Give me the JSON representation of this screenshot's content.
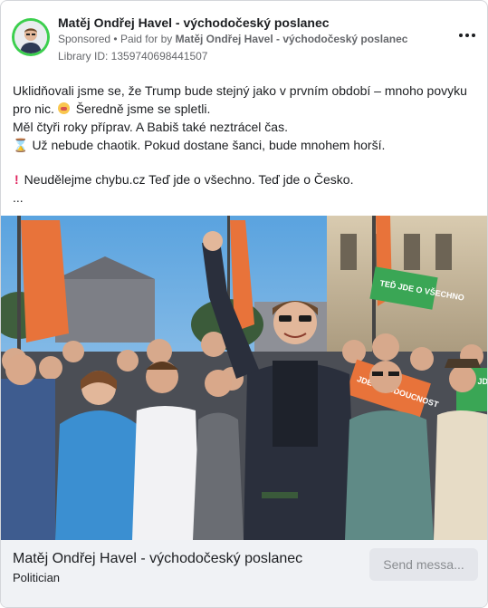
{
  "ad": {
    "page_name": "Matěj Ondřej Havel - východočeský poslanec",
    "sponsored_label": "Sponsored",
    "paid_for_prefix": "Paid for by",
    "paid_for_name": "Matěj Ondřej Havel - východočeský poslanec",
    "library_id": "Library ID: 1359740698441507",
    "more_icon": "more-horizontal-icon",
    "avatar_ring_color": "#3ccf4e"
  },
  "body": {
    "line1": "Uklidňovali jsme se, že Trump bude stejný jako v prvním období – mnoho povyku",
    "line2_pre": "pro nic.",
    "line2_post": "Šeredně jsme se spletli.",
    "line3": "Měl čtyři roky příprav. A Babiš také neztrácel čas.",
    "line4": "Už nebude chaotik. Pokud dostane šanci, bude mnohem horší.",
    "line5": "Neudělejme chybu.cz Teď jde o všechno. Teď jde o Česko.",
    "truncation": "..."
  },
  "photo": {
    "signs": [
      "TEĎ JDE O VŠECHNO",
      "JDE O BUDOUCNOST",
      "TEĎ JDE"
    ],
    "sign_colors": {
      "green": "#3aa655",
      "orange": "#e8733a"
    }
  },
  "footer": {
    "name": "Matěj Ondřej Havel - východočeský poslanec",
    "category": "Politician",
    "cta_label": "Send messa..."
  }
}
